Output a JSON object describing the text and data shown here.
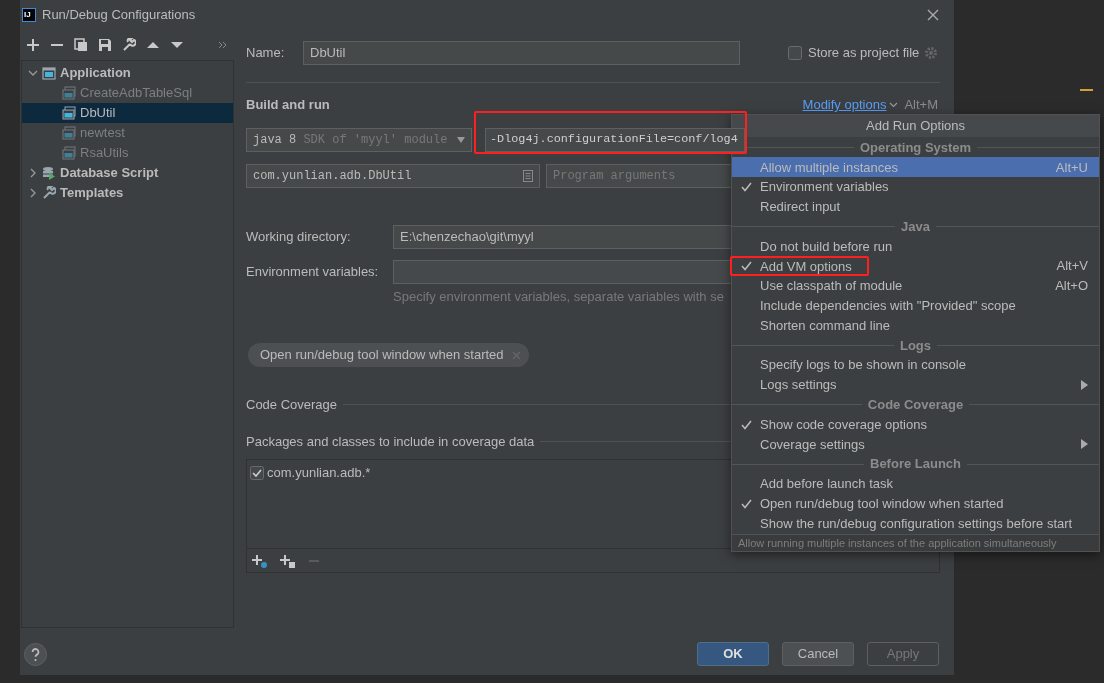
{
  "window": {
    "logo": "IJ",
    "title": "Run/Debug Configurations"
  },
  "tree": [
    {
      "label": "Application",
      "kind": "application",
      "expanded": true,
      "selected": false,
      "children": [
        {
          "label": "CreateAdbTableSql",
          "kind": "configuration",
          "temporary": true,
          "selected": false
        },
        {
          "label": "DbUtil",
          "kind": "configuration",
          "temporary": false,
          "selected": true
        },
        {
          "label": "newtest",
          "kind": "configuration",
          "temporary": true,
          "selected": false
        },
        {
          "label": "RsaUtils",
          "kind": "configuration",
          "temporary": true,
          "selected": false
        }
      ]
    },
    {
      "label": "Database Script",
      "kind": "database",
      "expanded": false,
      "selected": false
    },
    {
      "label": "Templates",
      "kind": "templates",
      "expanded": false,
      "selected": false
    }
  ],
  "form": {
    "name_label": "Name:",
    "name_value": "DbUtil",
    "store_label": "Store as project file",
    "store_checked": false,
    "section_title": "Build and run",
    "modify_link": "Modify options",
    "modify_shortcut": "Alt+M",
    "jre": {
      "value": "java 8",
      "hint": "SDK of 'myyl' module"
    },
    "vm_options": {
      "value": "-Dlog4j.configurationFile=conf/log4",
      "highlighted": true
    },
    "main_class": "com.yunlian.adb.DbUtil",
    "program_args": {
      "placeholder": "Program arguments"
    },
    "working_dir": {
      "label": "Working directory:",
      "value": "E:\\chenzechao\\git\\myyl"
    },
    "env": {
      "label": "Environment variables:",
      "hint": "Specify environment variables, separate variables with se"
    },
    "chips": [
      {
        "label": "Open run/debug tool window when started"
      }
    ]
  },
  "coverage": {
    "title": "Code Coverage",
    "packages_label": "Packages and classes to include in coverage data",
    "patterns": [
      {
        "label": "com.yunlian.adb.*",
        "checked": true
      }
    ]
  },
  "buttons": [
    {
      "label": "OK",
      "kind": "primary",
      "disabled": false
    },
    {
      "label": "Cancel",
      "kind": "default",
      "disabled": false
    },
    {
      "label": "Apply",
      "kind": "default",
      "disabled": true
    }
  ],
  "popup": {
    "title": "Add Run Options",
    "sections": [
      {
        "title": "Operating System",
        "items": [
          {
            "label": "Allow multiple instances",
            "checked": false,
            "selected": true,
            "highlighted": false,
            "has_submenu": false,
            "shortcut": "Alt+U"
          },
          {
            "label": "Environment variables",
            "checked": true,
            "selected": false,
            "highlighted": false,
            "has_submenu": false
          },
          {
            "label": "Redirect input",
            "checked": false,
            "selected": false,
            "highlighted": false,
            "has_submenu": false
          }
        ]
      },
      {
        "title": "Java",
        "items": [
          {
            "label": "Do not build before run",
            "checked": false,
            "selected": false,
            "highlighted": false,
            "has_submenu": false
          },
          {
            "label": "Add VM options",
            "checked": true,
            "selected": false,
            "highlighted": true,
            "has_submenu": false,
            "shortcut": "Alt+V"
          },
          {
            "label": "Use classpath of module",
            "checked": false,
            "selected": false,
            "highlighted": false,
            "has_submenu": false,
            "shortcut": "Alt+O"
          },
          {
            "label": "Include dependencies with \"Provided\" scope",
            "checked": false,
            "selected": false,
            "highlighted": false,
            "has_submenu": false
          },
          {
            "label": "Shorten command line",
            "checked": false,
            "selected": false,
            "highlighted": false,
            "has_submenu": false
          }
        ]
      },
      {
        "title": "Logs",
        "items": [
          {
            "label": "Specify logs to be shown in console",
            "checked": false,
            "selected": false,
            "highlighted": false,
            "has_submenu": false
          },
          {
            "label": "Logs settings",
            "checked": false,
            "selected": false,
            "highlighted": false,
            "has_submenu": true
          }
        ]
      },
      {
        "title": "Code Coverage",
        "items": [
          {
            "label": "Show code coverage options",
            "checked": true,
            "selected": false,
            "highlighted": false,
            "has_submenu": false
          },
          {
            "label": "Coverage settings",
            "checked": false,
            "selected": false,
            "highlighted": false,
            "has_submenu": true
          }
        ]
      },
      {
        "title": "Before Launch",
        "items": [
          {
            "label": "Add before launch task",
            "checked": false,
            "selected": false,
            "highlighted": false,
            "has_submenu": false
          },
          {
            "label": "Open run/debug tool window when started",
            "checked": true,
            "selected": false,
            "highlighted": false,
            "has_submenu": false
          },
          {
            "label": "Show the run/debug configuration settings before start",
            "checked": false,
            "selected": false,
            "highlighted": false,
            "has_submenu": false
          }
        ]
      }
    ],
    "footer": "Allow running multiple instances of the application simultaneously"
  }
}
